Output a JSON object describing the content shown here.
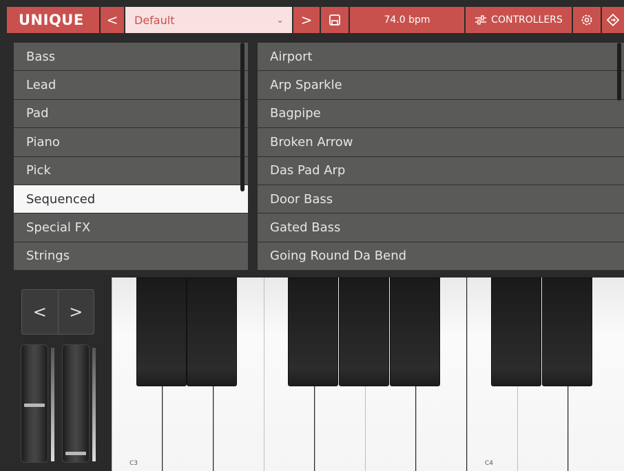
{
  "app": {
    "logo": "UNIQUE"
  },
  "toolbar": {
    "prev_label": "<",
    "preset_value": "Default",
    "preset_caret": "⌄",
    "next_label": ">",
    "tempo": "74.0 bpm",
    "controllers_label": "CONTROLLERS"
  },
  "categories": {
    "items": [
      "Bass",
      "Lead",
      "Pad",
      "Piano",
      "Pick",
      "Sequenced",
      "Special FX",
      "Strings"
    ],
    "selected": "Sequenced"
  },
  "patches": {
    "items": [
      "Airport",
      "Arp Sparkle",
      "Bagpipe",
      "Broken Arrow",
      "Das Pad Arp",
      "Door Bass",
      "Gated Bass",
      "Going Round Da Bend"
    ]
  },
  "keyboard": {
    "octave_down": "<",
    "octave_up": ">",
    "label_c3": "C3",
    "label_c4": "C4"
  },
  "colors": {
    "accent": "#c9514d",
    "preset_bg": "#f8e1e0",
    "row_bg": "#5a5a58",
    "selected_bg": "#f7f7f7"
  },
  "icons": {
    "save": "save-icon",
    "controllers": "sliders-icon",
    "settings": "gear-icon",
    "extra": "diamond-arrows-icon"
  }
}
